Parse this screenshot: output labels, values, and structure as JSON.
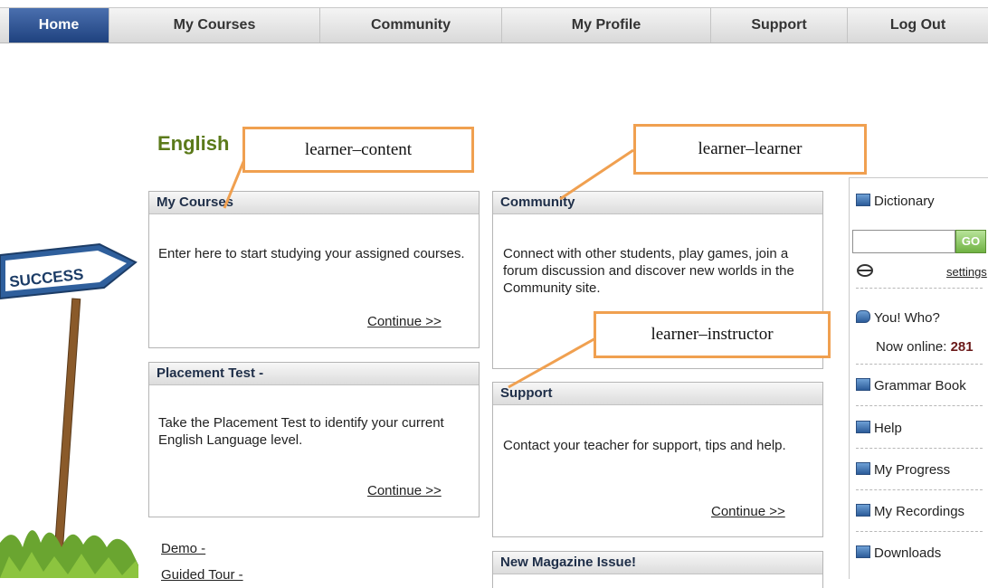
{
  "nav": {
    "tabs": [
      {
        "label": "Home",
        "active": true
      },
      {
        "label": "My Courses"
      },
      {
        "label": "Community"
      },
      {
        "label": "My Profile"
      },
      {
        "label": "Support"
      },
      {
        "label": "Log Out"
      }
    ]
  },
  "page_title": "English",
  "sign_text": "SUCCESS",
  "sections": {
    "my_courses": {
      "title": "My Courses",
      "text": "Enter here to start studying your assigned courses.",
      "continue": "Continue >>"
    },
    "placement": {
      "title": "Placement Test -",
      "text": "Take the Placement Test to identify your current English Language level.",
      "continue": "Continue >>"
    },
    "community": {
      "title": "Community",
      "text": "Connect with other students, play games, join a forum discussion and discover new worlds in the Community site."
    },
    "support": {
      "title": "Support",
      "text": "Contact your teacher for support, tips and help.",
      "continue": "Continue >>"
    },
    "magazine": {
      "title": "New Magazine Issue!"
    }
  },
  "links": {
    "demo": "Demo -",
    "guided_tour": "Guided Tour -"
  },
  "callouts": {
    "content": "learner–content",
    "learner": "learner–learner",
    "instructor": "learner–instructor"
  },
  "sidebar": {
    "dictionary": "Dictionary",
    "go": "GO",
    "settings": "settings",
    "you_who": "You! Who?",
    "now_online_label": "Now online:",
    "now_online_count": "281",
    "grammar_book": "Grammar Book",
    "help": "Help",
    "my_progress": "My Progress",
    "my_recordings": "My Recordings",
    "downloads": "Downloads"
  },
  "colors": {
    "nav_active": "#2a4d8f",
    "callout_border": "#f0a050",
    "title_green": "#5b7a1a"
  }
}
